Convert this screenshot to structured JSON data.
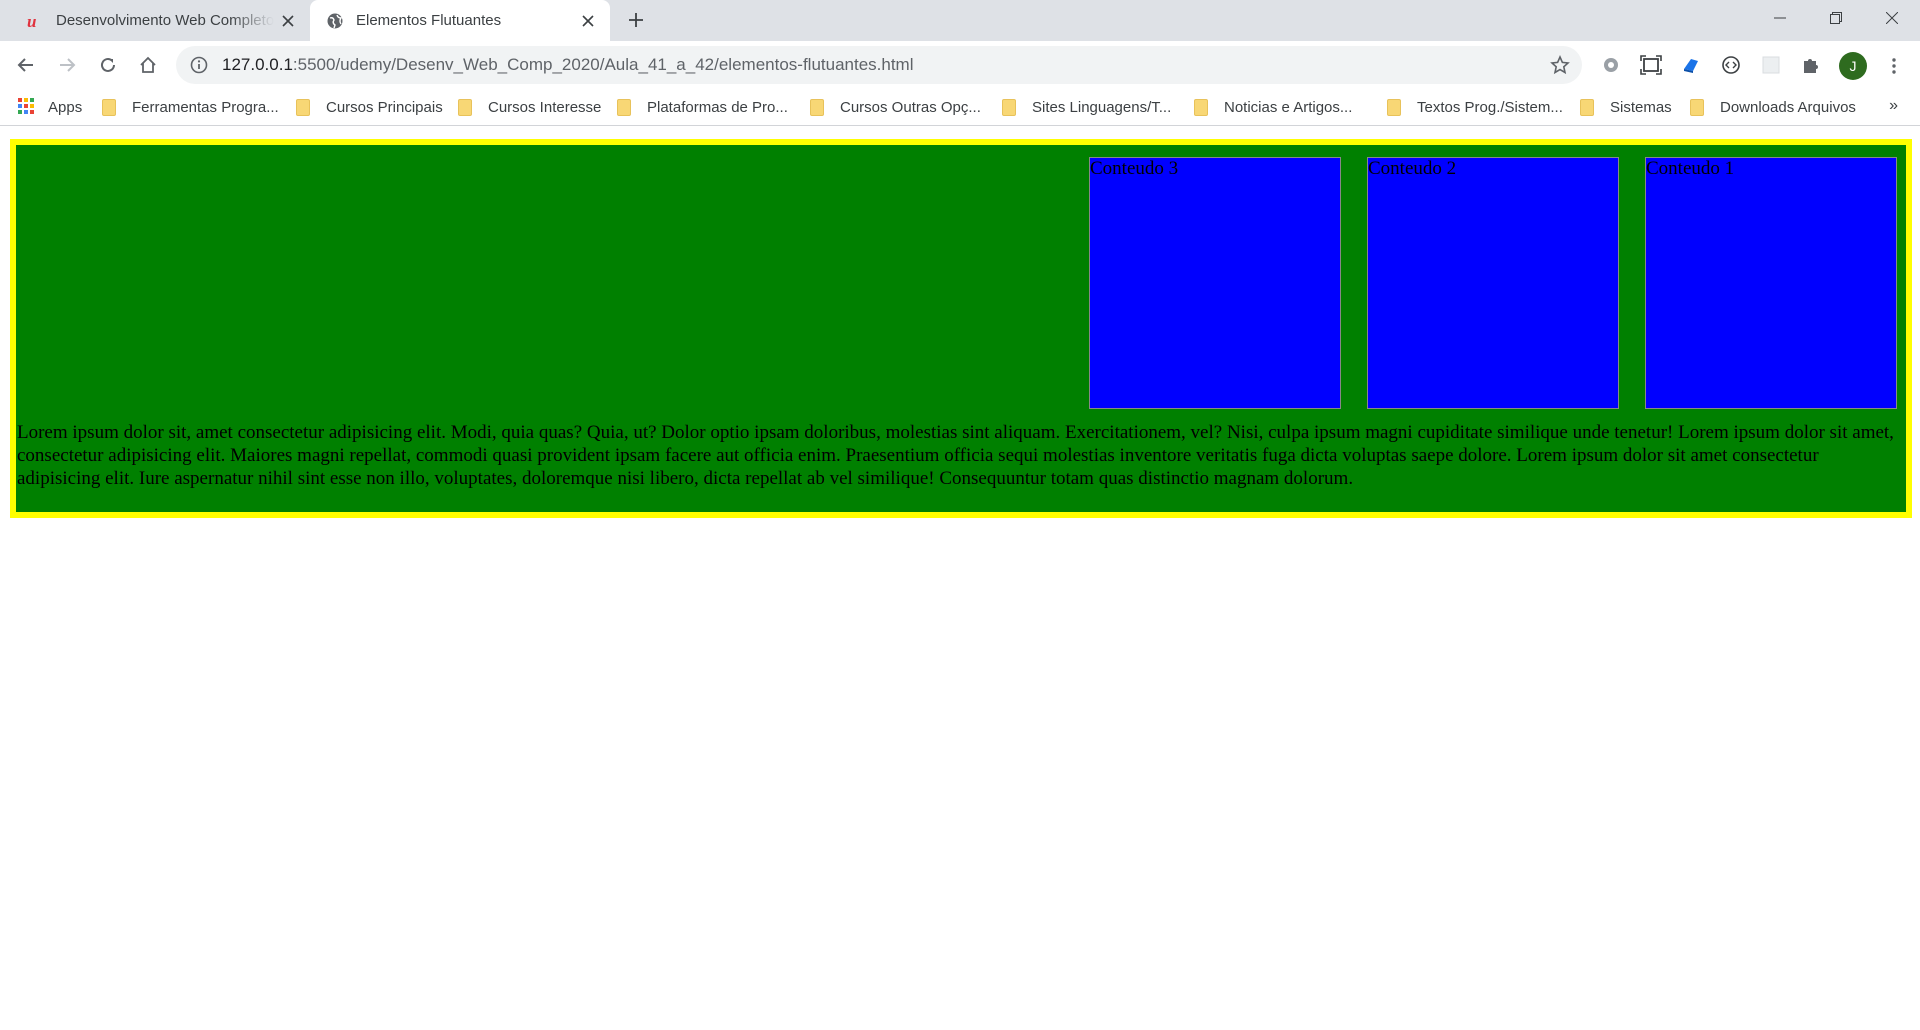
{
  "browser": {
    "tabs": [
      {
        "title": "Desenvolvimento Web Completo",
        "active": false,
        "favicon": "udemy-icon"
      },
      {
        "title": "Elementos Flutuantes",
        "active": true,
        "favicon": "globe-icon"
      }
    ],
    "address_bar": {
      "host": "127.0.0.1",
      "path": ":5500/udemy/Desenv_Web_Comp_2020/Aula_41_a_42/elementos-flutuantes.html"
    },
    "profile_initial": "J",
    "bookmarks": [
      {
        "label": "Apps",
        "icon": "apps-grid-icon"
      },
      {
        "label": "Ferramentas Progra...",
        "icon": "folder-icon"
      },
      {
        "label": "Cursos Principais",
        "icon": "folder-icon"
      },
      {
        "label": "Cursos Interesse",
        "icon": "folder-icon"
      },
      {
        "label": "Plataformas de Pro...",
        "icon": "folder-icon"
      },
      {
        "label": "Cursos Outras Opç...",
        "icon": "folder-icon"
      },
      {
        "label": "Sites Linguagens/T...",
        "icon": "folder-icon"
      },
      {
        "label": "Noticias e Artigos...",
        "icon": "folder-icon"
      },
      {
        "label": "Textos Prog./Sistem...",
        "icon": "folder-icon"
      },
      {
        "label": "Sistemas",
        "icon": "folder-icon"
      },
      {
        "label": "Downloads Arquivos",
        "icon": "folder-icon"
      }
    ],
    "more_bookmarks": "»"
  },
  "page": {
    "colors": {
      "container_bg": "#008000",
      "container_border": "#ffff00",
      "box_bg": "#0000ff"
    },
    "boxes": [
      {
        "label": "Conteudo 1"
      },
      {
        "label": "Conteudo 2"
      },
      {
        "label": "Conteudo 3"
      }
    ],
    "paragraph": "Lorem ipsum dolor sit, amet consectetur adipisicing elit. Modi, quia quas? Quia, ut? Dolor optio ipsam doloribus, molestias sint aliquam. Exercitationem, vel? Nisi, culpa ipsum magni cupiditate similique unde tenetur! Lorem ipsum dolor sit amet, consectetur adipisicing elit. Maiores magni repellat, commodi quasi provident ipsam facere aut officia enim. Praesentium officia sequi molestias inventore veritatis fuga dicta voluptas saepe dolore. Lorem ipsum dolor sit amet consectetur adipisicing elit. Iure aspernatur nihil sint esse non illo, voluptates, doloremque nisi libero, dicta repellat ab vel similique! Consequuntur totam quas distinctio magnam dolorum."
  }
}
